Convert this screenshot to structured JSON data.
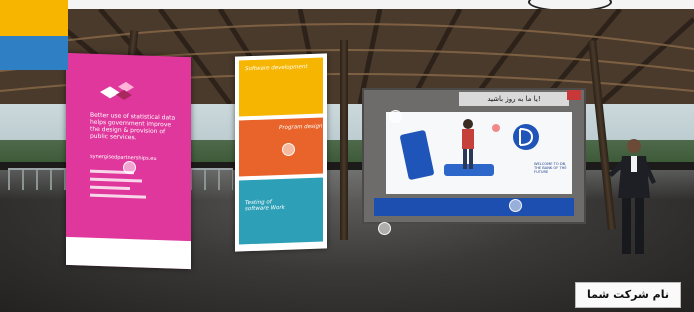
{
  "screen": {
    "header_text": "یا ما به روز باشید!",
    "welcome_text": "WELCOME TO DB, THE BANK OF THE FUTURE"
  },
  "poster_left": {
    "headline": "Better use of statistical data helps government improve the design & provision of public services.",
    "url": "synergisedpartnerships.eu"
  },
  "poster_middle": {
    "sections": [
      "Software development",
      "Program design",
      "Testing of software Work"
    ]
  },
  "company_label": "نام شرکت شما",
  "colors": {
    "pink": "#e0379c",
    "yellow": "#f6b500",
    "orange": "#e8642a",
    "teal": "#2da0b7",
    "blue": "#1d4fb0"
  }
}
